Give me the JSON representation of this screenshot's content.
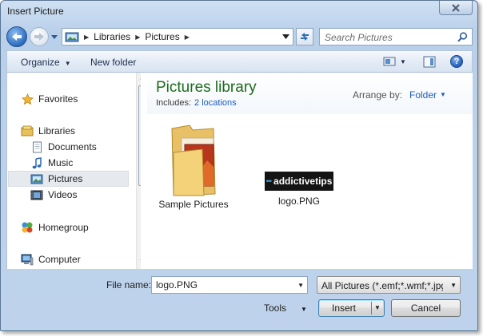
{
  "window": {
    "title": "Insert Picture",
    "close_icon": "close-x"
  },
  "nav": {
    "breadcrumbs": [
      "Libraries",
      "Pictures"
    ],
    "search_placeholder": "Search Pictures"
  },
  "toolbar": {
    "organize_label": "Organize",
    "new_folder_label": "New folder",
    "help_label": "?"
  },
  "sidebar": {
    "items": [
      {
        "label": "Favorites",
        "icon": "star-icon",
        "selected": false
      },
      {
        "label": "Libraries",
        "icon": "libraries-icon",
        "selected": false
      },
      {
        "label": "Documents",
        "icon": "documents-icon",
        "selected": false
      },
      {
        "label": "Music",
        "icon": "music-icon",
        "selected": false
      },
      {
        "label": "Pictures",
        "icon": "pictures-icon",
        "selected": true
      },
      {
        "label": "Videos",
        "icon": "videos-icon",
        "selected": false
      },
      {
        "label": "Homegroup",
        "icon": "homegroup-icon",
        "selected": false
      },
      {
        "label": "Computer",
        "icon": "computer-icon",
        "selected": false
      }
    ]
  },
  "library": {
    "title": "Pictures library",
    "includes_label": "Includes:",
    "includes_link": "2 locations",
    "arrange_label": "Arrange by:",
    "arrange_value": "Folder"
  },
  "files": [
    {
      "name": "Sample Pictures",
      "icon": "folder-icon"
    },
    {
      "name": "logo.PNG",
      "icon": "image-thumbnail",
      "thumb_text": "addictivetips"
    }
  ],
  "footer": {
    "file_name_label": "File name:",
    "file_name_value": "logo.PNG",
    "filter_value": "All Pictures (*.emf;*.wmf;*.jpg;*",
    "tools_label": "Tools",
    "insert_label": "Insert",
    "cancel_label": "Cancel"
  },
  "colors": {
    "library_title": "#1d6b1d",
    "link": "#1a5cc0",
    "frame": "#bed3eb"
  }
}
